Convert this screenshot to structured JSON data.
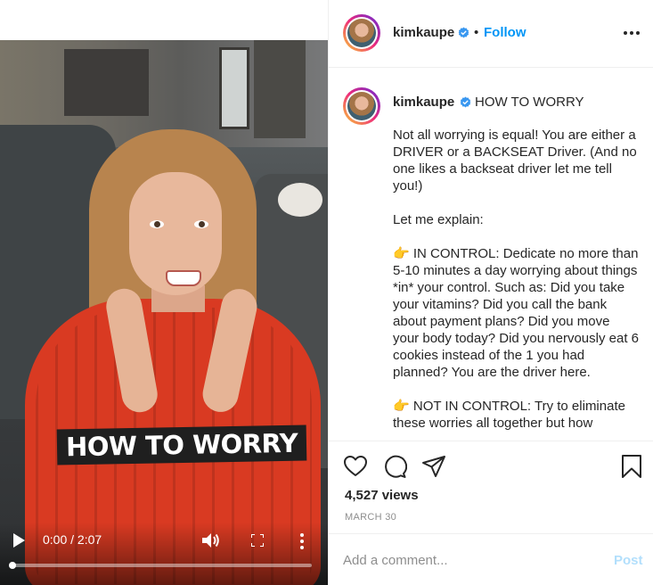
{
  "video": {
    "overlay_text": "HOW TO WORRY",
    "time": "0:00 / 2:07",
    "progress": 0.0,
    "icons": {
      "play": "play-icon",
      "volume": "volume-icon",
      "fullscreen": "fullscreen-icon",
      "more": "more-vertical-icon"
    }
  },
  "header": {
    "username": "kimkaupe",
    "separator": "•",
    "follow_label": "Follow",
    "verified_icon": "verified-badge-icon",
    "options_icon": "more-horizontal-icon"
  },
  "caption": {
    "username": "kimkaupe",
    "title": "HOW TO WORRY",
    "paragraphs": [
      "Not all worrying is equal! You are either a DRIVER or a BACKSEAT Driver. (And no one likes a backseat driver let me tell you!)",
      "Let me explain:",
      "IN CONTROL: Dedicate no more than 5-10 minutes a day worrying about things *in* your control. Such as: Did you take your vitamins? Did you call the bank about payment plans? Did you move your body today? Did you nervously eat 6 cookies instead of the 1 you had planned? You are the driver here.",
      "NOT IN CONTROL: Try to eliminate these worries all together but how"
    ],
    "pointer_icon": "👉"
  },
  "actions": {
    "views": "4,527 views",
    "date": "MARCH 30",
    "icons": {
      "like": "heart-icon",
      "comment": "comment-icon",
      "share": "share-icon",
      "save": "bookmark-icon"
    }
  },
  "comment_box": {
    "placeholder": "Add a comment...",
    "post_label": "Post"
  },
  "colors": {
    "accent": "#0095f6",
    "post_disabled": "#b2dffc",
    "muted": "#8e8e8e",
    "text": "#262626"
  }
}
